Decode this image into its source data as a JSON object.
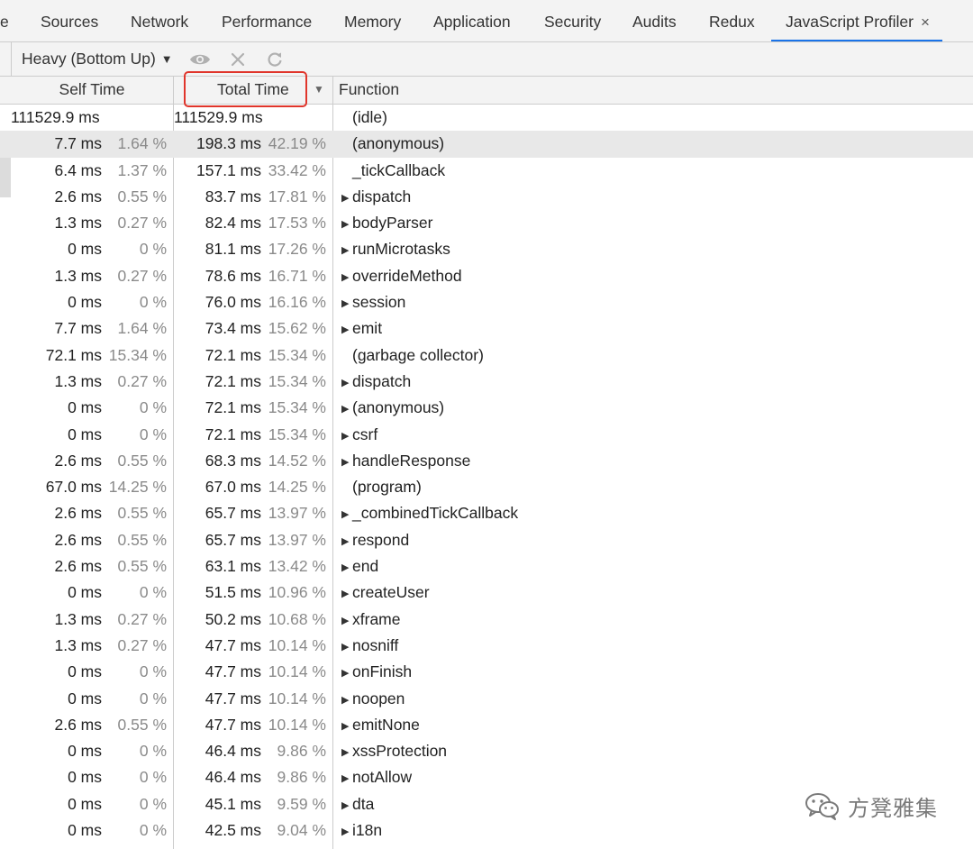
{
  "tabs": [
    {
      "label": "e"
    },
    {
      "label": "Sources"
    },
    {
      "label": "Network"
    },
    {
      "label": "Performance"
    },
    {
      "label": "Memory"
    },
    {
      "label": "Application"
    },
    {
      "label": "Security"
    },
    {
      "label": "Audits"
    },
    {
      "label": "Redux"
    },
    {
      "label": "JavaScript Profiler",
      "active": true,
      "close": "×"
    }
  ],
  "toolbar": {
    "view_select": "Heavy (Bottom Up)",
    "view_select_arrow": "▼",
    "icons": [
      "eye-icon",
      "close-icon",
      "reload-icon"
    ]
  },
  "columns": {
    "self_time": "Self Time",
    "total_time": "Total Time",
    "sort_indicator": "▼",
    "function": "Function"
  },
  "rows": [
    {
      "self_ms": "111529.9 ms",
      "self_pct": "",
      "total_ms": "111529.9 ms",
      "total_pct": "",
      "func": "(idle)",
      "expand": ""
    },
    {
      "self_ms": "7.7 ms",
      "self_pct": "1.64 %",
      "total_ms": "198.3 ms",
      "total_pct": "42.19 %",
      "func": "(anonymous)",
      "expand": "",
      "selected": true
    },
    {
      "self_ms": "6.4 ms",
      "self_pct": "1.37 %",
      "total_ms": "157.1 ms",
      "total_pct": "33.42 %",
      "func": "_tickCallback",
      "expand": ""
    },
    {
      "self_ms": "2.6 ms",
      "self_pct": "0.55 %",
      "total_ms": "83.7 ms",
      "total_pct": "17.81 %",
      "func": "dispatch",
      "expand": "▶"
    },
    {
      "self_ms": "1.3 ms",
      "self_pct": "0.27 %",
      "total_ms": "82.4 ms",
      "total_pct": "17.53 %",
      "func": "bodyParser",
      "expand": "▶"
    },
    {
      "self_ms": "0 ms",
      "self_pct": "0 %",
      "total_ms": "81.1 ms",
      "total_pct": "17.26 %",
      "func": "runMicrotasks",
      "expand": "▶"
    },
    {
      "self_ms": "1.3 ms",
      "self_pct": "0.27 %",
      "total_ms": "78.6 ms",
      "total_pct": "16.71 %",
      "func": "overrideMethod",
      "expand": "▶"
    },
    {
      "self_ms": "0 ms",
      "self_pct": "0 %",
      "total_ms": "76.0 ms",
      "total_pct": "16.16 %",
      "func": "session",
      "expand": "▶"
    },
    {
      "self_ms": "7.7 ms",
      "self_pct": "1.64 %",
      "total_ms": "73.4 ms",
      "total_pct": "15.62 %",
      "func": "emit",
      "expand": "▶"
    },
    {
      "self_ms": "72.1 ms",
      "self_pct": "15.34 %",
      "total_ms": "72.1 ms",
      "total_pct": "15.34 %",
      "func": "(garbage collector)",
      "expand": ""
    },
    {
      "self_ms": "1.3 ms",
      "self_pct": "0.27 %",
      "total_ms": "72.1 ms",
      "total_pct": "15.34 %",
      "func": "dispatch",
      "expand": "▶"
    },
    {
      "self_ms": "0 ms",
      "self_pct": "0 %",
      "total_ms": "72.1 ms",
      "total_pct": "15.34 %",
      "func": "(anonymous)",
      "expand": "▶"
    },
    {
      "self_ms": "0 ms",
      "self_pct": "0 %",
      "total_ms": "72.1 ms",
      "total_pct": "15.34 %",
      "func": "csrf",
      "expand": "▶"
    },
    {
      "self_ms": "2.6 ms",
      "self_pct": "0.55 %",
      "total_ms": "68.3 ms",
      "total_pct": "14.52 %",
      "func": "handleResponse",
      "expand": "▶"
    },
    {
      "self_ms": "67.0 ms",
      "self_pct": "14.25 %",
      "total_ms": "67.0 ms",
      "total_pct": "14.25 %",
      "func": "(program)",
      "expand": ""
    },
    {
      "self_ms": "2.6 ms",
      "self_pct": "0.55 %",
      "total_ms": "65.7 ms",
      "total_pct": "13.97 %",
      "func": "_combinedTickCallback",
      "expand": "▶"
    },
    {
      "self_ms": "2.6 ms",
      "self_pct": "0.55 %",
      "total_ms": "65.7 ms",
      "total_pct": "13.97 %",
      "func": "respond",
      "expand": "▶"
    },
    {
      "self_ms": "2.6 ms",
      "self_pct": "0.55 %",
      "total_ms": "63.1 ms",
      "total_pct": "13.42 %",
      "func": "end",
      "expand": "▶"
    },
    {
      "self_ms": "0 ms",
      "self_pct": "0 %",
      "total_ms": "51.5 ms",
      "total_pct": "10.96 %",
      "func": "createUser",
      "expand": "▶"
    },
    {
      "self_ms": "1.3 ms",
      "self_pct": "0.27 %",
      "total_ms": "50.2 ms",
      "total_pct": "10.68 %",
      "func": "xframe",
      "expand": "▶"
    },
    {
      "self_ms": "1.3 ms",
      "self_pct": "0.27 %",
      "total_ms": "47.7 ms",
      "total_pct": "10.14 %",
      "func": "nosniff",
      "expand": "▶"
    },
    {
      "self_ms": "0 ms",
      "self_pct": "0 %",
      "total_ms": "47.7 ms",
      "total_pct": "10.14 %",
      "func": "onFinish",
      "expand": "▶"
    },
    {
      "self_ms": "0 ms",
      "self_pct": "0 %",
      "total_ms": "47.7 ms",
      "total_pct": "10.14 %",
      "func": "noopen",
      "expand": "▶"
    },
    {
      "self_ms": "2.6 ms",
      "self_pct": "0.55 %",
      "total_ms": "47.7 ms",
      "total_pct": "10.14 %",
      "func": "emitNone",
      "expand": "▶"
    },
    {
      "self_ms": "0 ms",
      "self_pct": "0 %",
      "total_ms": "46.4 ms",
      "total_pct": "9.86 %",
      "func": "xssProtection",
      "expand": "▶"
    },
    {
      "self_ms": "0 ms",
      "self_pct": "0 %",
      "total_ms": "46.4 ms",
      "total_pct": "9.86 %",
      "func": "notAllow",
      "expand": "▶"
    },
    {
      "self_ms": "0 ms",
      "self_pct": "0 %",
      "total_ms": "45.1 ms",
      "total_pct": "9.59 %",
      "func": "dta",
      "expand": "▶"
    },
    {
      "self_ms": "0 ms",
      "self_pct": "0 %",
      "total_ms": "42.5 ms",
      "total_pct": "9.04 %",
      "func": "i18n",
      "expand": "▶"
    }
  ],
  "watermark": {
    "text": "方凳雅集",
    "icon": "wechat-icon"
  },
  "colors": {
    "accent": "#1a73e8",
    "highlight": "#e0352b",
    "selected_row": "#e8e8e8",
    "muted": "#8a8a8a"
  }
}
